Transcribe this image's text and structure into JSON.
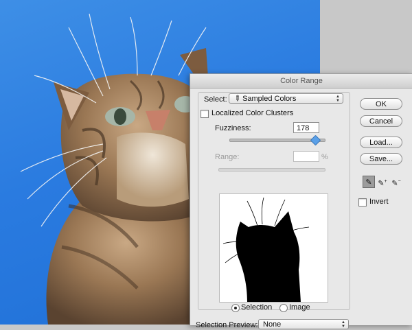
{
  "dialog": {
    "title": "Color Range",
    "select_label": "Select:",
    "select_value": "Sampled Colors",
    "localized_clusters_label": "Localized Color Clusters",
    "localized_clusters_checked": false,
    "fuzziness_label": "Fuzziness:",
    "fuzziness_value": "178",
    "fuzziness_fraction": 0.89,
    "range_label": "Range:",
    "range_value": "",
    "range_unit": "%",
    "view_options": [
      {
        "label": "Selection",
        "selected": true
      },
      {
        "label": "Image",
        "selected": false
      }
    ],
    "selection_preview_label": "Selection Preview:",
    "selection_preview_value": "None",
    "buttons": {
      "ok": "OK",
      "cancel": "Cancel",
      "load": "Load...",
      "save": "Save..."
    },
    "tools": [
      "eyedropper-icon",
      "eyedropper-plus-icon",
      "eyedropper-minus-icon"
    ],
    "invert_label": "Invert",
    "invert_checked": false
  },
  "colors": {
    "photo_sky": "#2a7be0",
    "slider_thumb": "#5aa0e8",
    "dialog_bg": "#e8e8e8"
  }
}
